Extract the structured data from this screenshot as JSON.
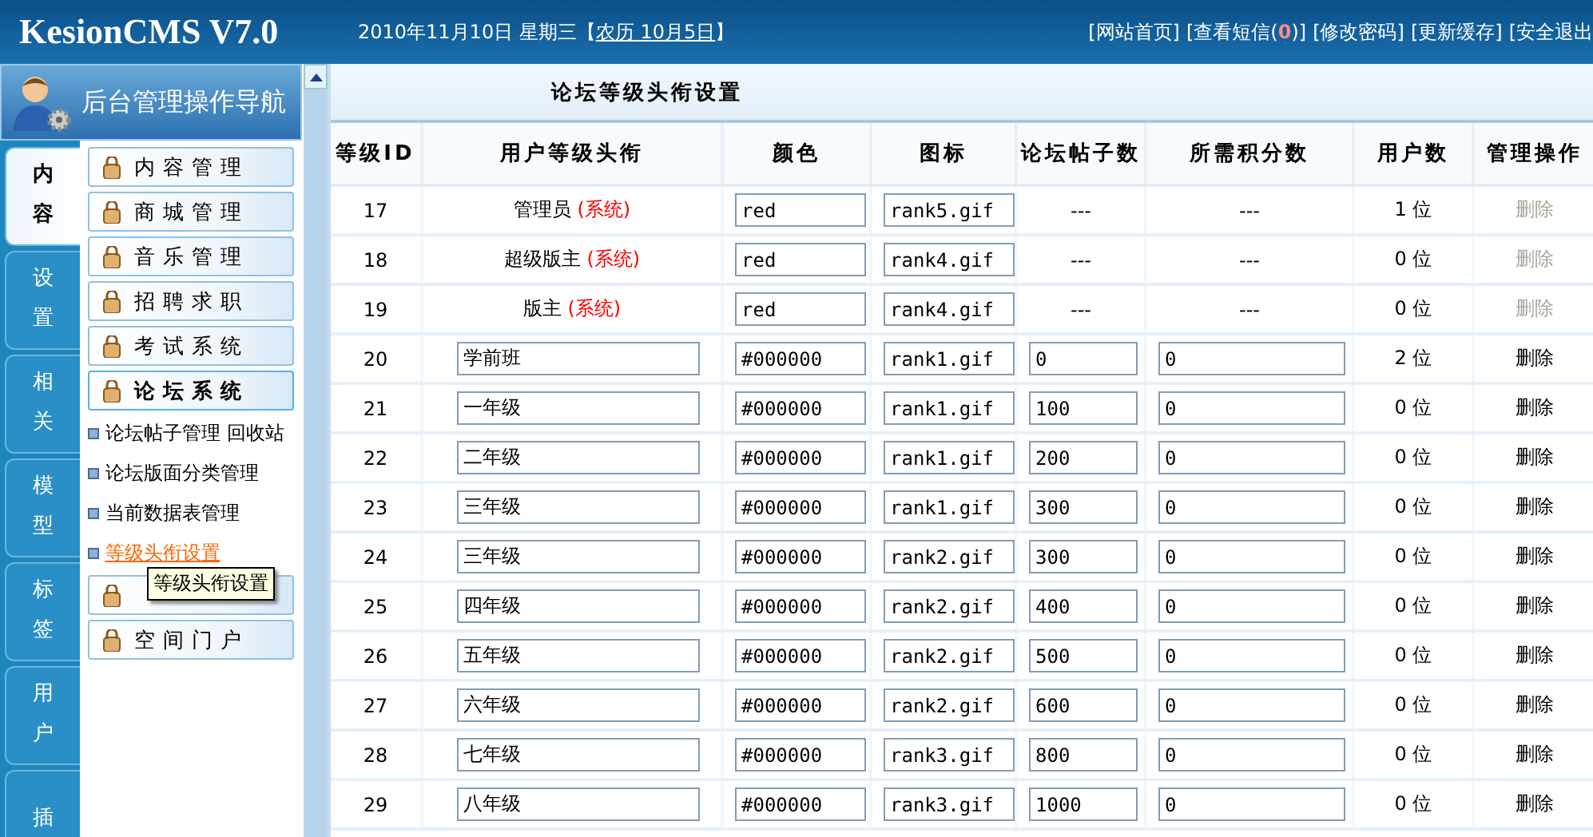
{
  "header": {
    "logo": "KesionCMS V7.0",
    "date": "2010年11月10日 星期三【",
    "lunar": "农历 10月5日",
    "date_end": "】",
    "links": [
      {
        "kind": "plain",
        "label": "[网站首页]"
      },
      {
        "kind": "count",
        "label": "[查看短信(",
        "count": "0",
        "end": ")]"
      },
      {
        "kind": "plain",
        "label": "[修改密码]"
      },
      {
        "kind": "plain",
        "label": "[更新缓存]"
      },
      {
        "kind": "plain",
        "label": "[安全退出"
      }
    ]
  },
  "nav": {
    "title": "后台管理操作导航",
    "tabs": [
      {
        "label": "内容",
        "selected": true
      },
      {
        "label": "设置",
        "selected": false
      },
      {
        "label": "相关",
        "selected": false
      },
      {
        "label": "模型",
        "selected": false
      },
      {
        "label": "标签",
        "selected": false
      },
      {
        "label": "用户",
        "selected": false
      },
      {
        "label": "插",
        "selected": false
      }
    ],
    "groups": [
      {
        "label": "内容管理",
        "expanded": false
      },
      {
        "label": "商城管理",
        "expanded": false
      },
      {
        "label": "音乐管理",
        "expanded": false
      },
      {
        "label": "招聘求职",
        "expanded": false
      },
      {
        "label": "考试系统",
        "expanded": false
      },
      {
        "label": "论坛系统",
        "expanded": true,
        "children": [
          {
            "links": [
              {
                "label": "论坛帖子管理",
                "selected": false
              },
              {
                "label": "回收站",
                "selected": false
              }
            ]
          },
          {
            "links": [
              {
                "label": "论坛版面分类管理",
                "selected": false
              }
            ]
          },
          {
            "links": [
              {
                "label": "当前数据表管理",
                "selected": false
              }
            ]
          },
          {
            "links": [
              {
                "label": "等级头衔设置",
                "selected": true
              }
            ]
          }
        ]
      },
      {
        "expanded": false
      },
      {
        "label": "空间门户",
        "expanded": false
      }
    ],
    "tooltip": "等级头衔设置"
  },
  "page": {
    "title": "论坛等级头衔设置",
    "columns": [
      "等级ID",
      "用户等级头衔",
      "颜色",
      "图标",
      "论坛帖子数",
      "所需积分数",
      "用户数",
      "管理操作"
    ],
    "rows": [
      {
        "id": "17",
        "kind": "system",
        "name": "管理员",
        "tag": "(系统)",
        "color_value": "red",
        "icon": "rank5.gif",
        "posts": "---",
        "points": "---",
        "users": "1 位",
        "action": "删除",
        "disabled": true
      },
      {
        "id": "18",
        "kind": "system",
        "name": "超级版主",
        "tag": "(系统)",
        "color_value": "red",
        "icon": "rank4.gif",
        "posts": "---",
        "points": "---",
        "users": "0 位",
        "action": "删除",
        "disabled": true
      },
      {
        "id": "19",
        "kind": "system",
        "name": "版主",
        "tag": "(系统)",
        "color_value": "red",
        "icon": "rank4.gif",
        "posts": "---",
        "points": "---",
        "users": "0 位",
        "action": "删除",
        "disabled": true
      },
      {
        "id": "20",
        "kind": "custom",
        "name": "学前班",
        "color_value": "#000000",
        "icon": "rank1.gif",
        "posts": "0",
        "points": "0",
        "users": "2 位",
        "action": "删除",
        "disabled": false
      },
      {
        "id": "21",
        "kind": "custom",
        "name": "一年级",
        "color_value": "#000000",
        "icon": "rank1.gif",
        "posts": "100",
        "points": "0",
        "users": "0 位",
        "action": "删除",
        "disabled": false
      },
      {
        "id": "22",
        "kind": "custom",
        "name": "二年级",
        "color_value": "#000000",
        "icon": "rank1.gif",
        "posts": "200",
        "points": "0",
        "users": "0 位",
        "action": "删除",
        "disabled": false
      },
      {
        "id": "23",
        "kind": "custom",
        "name": "三年级",
        "color_value": "#000000",
        "icon": "rank1.gif",
        "posts": "300",
        "points": "0",
        "users": "0 位",
        "action": "删除",
        "disabled": false
      },
      {
        "id": "24",
        "kind": "custom",
        "name": "三年级",
        "color_value": "#000000",
        "icon": "rank2.gif",
        "posts": "300",
        "points": "0",
        "users": "0 位",
        "action": "删除",
        "disabled": false
      },
      {
        "id": "25",
        "kind": "custom",
        "name": "四年级",
        "color_value": "#000000",
        "icon": "rank2.gif",
        "posts": "400",
        "points": "0",
        "users": "0 位",
        "action": "删除",
        "disabled": false
      },
      {
        "id": "26",
        "kind": "custom",
        "name": "五年级",
        "color_value": "#000000",
        "icon": "rank2.gif",
        "posts": "500",
        "points": "0",
        "users": "0 位",
        "action": "删除",
        "disabled": false
      },
      {
        "id": "27",
        "kind": "custom",
        "name": "六年级",
        "color_value": "#000000",
        "icon": "rank2.gif",
        "posts": "600",
        "points": "0",
        "users": "0 位",
        "action": "删除",
        "disabled": false
      },
      {
        "id": "28",
        "kind": "custom",
        "name": "七年级",
        "color_value": "#000000",
        "icon": "rank3.gif",
        "posts": "800",
        "points": "0",
        "users": "0 位",
        "action": "删除",
        "disabled": false
      },
      {
        "id": "29",
        "kind": "custom",
        "name": "八年级",
        "color_value": "#000000",
        "icon": "rank3.gif",
        "posts": "1000",
        "points": "0",
        "users": "0 位",
        "action": "删除",
        "disabled": false
      }
    ]
  }
}
